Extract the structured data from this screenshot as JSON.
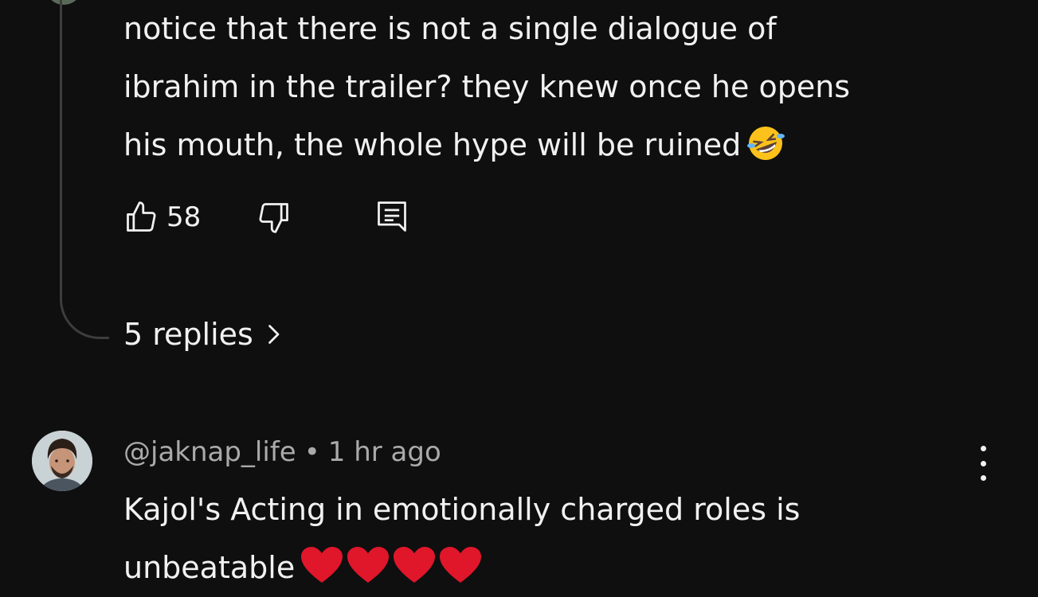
{
  "comment1": {
    "lines": [
      "notice that there is not a single dialogue of",
      "ibrahim in the trailer? they knew once he opens",
      "his mouth, the whole hype will be ruined"
    ],
    "emoji": "rofl-emoji",
    "likes": "58"
  },
  "replies_label": "5 replies",
  "comment2": {
    "author": "@jaknap_life",
    "separator": "•",
    "time": "1 hr ago",
    "lines": [
      "Kajol's Acting in emotionally charged roles is",
      "unbeatable"
    ],
    "emoji": "red-heart-emoji x4"
  },
  "colors": {
    "background": "#0f0f0f",
    "text": "#f1f1f1",
    "meta": "#aaaaaa",
    "thread_line": "#3d3d3d",
    "heart": "#e0162b",
    "emoji_yellow": "#fcc21b"
  }
}
